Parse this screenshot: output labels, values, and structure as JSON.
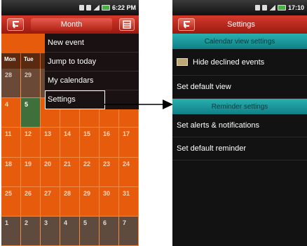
{
  "left": {
    "status": {
      "time": "6:22 PM"
    },
    "title": "Month",
    "weekdays": [
      "Mon",
      "Tue",
      "",
      "",
      "",
      "",
      ""
    ],
    "rows": [
      [
        "28",
        "29",
        "",
        "",
        "",
        "",
        ""
      ],
      [
        "4",
        "5",
        "",
        "",
        "",
        "",
        ""
      ],
      [
        "11",
        "12",
        "13",
        "14",
        "15",
        "16",
        "17"
      ],
      [
        "18",
        "19",
        "20",
        "21",
        "22",
        "23",
        "24"
      ],
      [
        "25",
        "26",
        "27",
        "28",
        "29",
        "30",
        "31"
      ],
      [
        "1",
        "2",
        "3",
        "4",
        "5",
        "6",
        "7"
      ]
    ],
    "menu": [
      "New event",
      "Jump to today",
      "My calendars",
      "Settings"
    ]
  },
  "right": {
    "status": {
      "time": "17:10"
    },
    "title": "Settings",
    "sections": {
      "calendar_view": "Calendar view settings",
      "reminder": "Reminder settings"
    },
    "items": {
      "hide_declined": "Hide declined events",
      "default_view": "Set default view",
      "alerts": "Set alerts & notifications",
      "default_reminder": "Set default reminder"
    }
  },
  "colors": {
    "calendar_orange": "#e65c0c",
    "title_red": "#c42c1f",
    "section_teal": "#1a9aa0"
  }
}
